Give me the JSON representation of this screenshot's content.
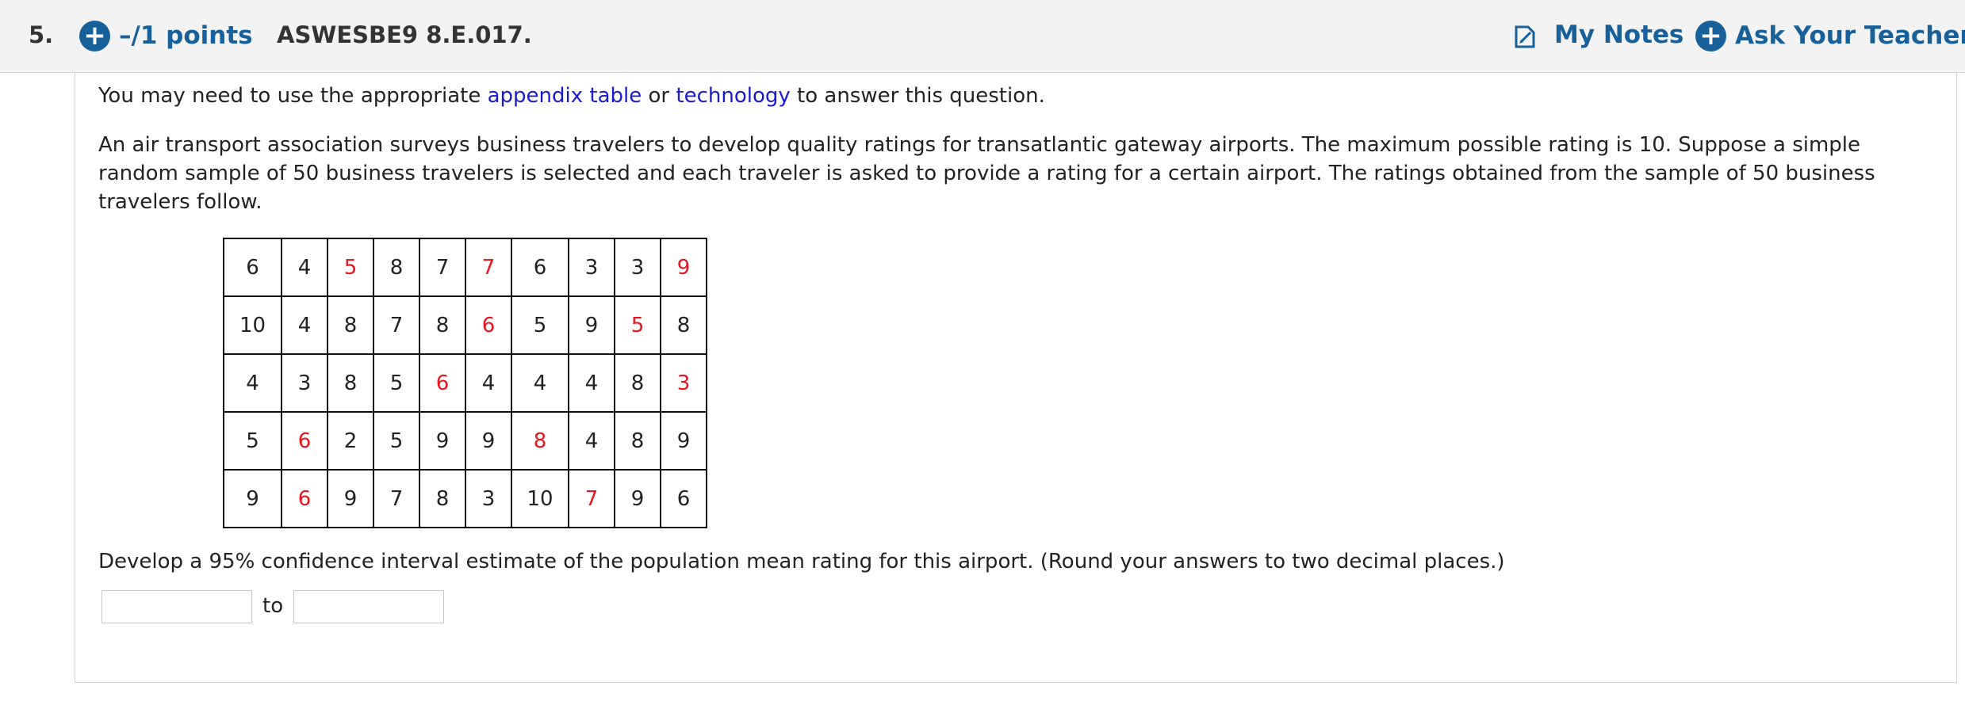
{
  "header": {
    "question_number": "5.",
    "points_label": "–/1 points",
    "question_id": "ASWESBE9 8.E.017.",
    "my_notes_label": "My Notes",
    "ask_teacher_label": "Ask Your Teacher"
  },
  "intro": {
    "prefix": "You may need to use the appropriate ",
    "link1": "appendix table",
    "middle": " or ",
    "link2": "technology",
    "suffix": " to answer this question."
  },
  "paragraph": "An air transport association surveys business travelers to develop quality ratings for transatlantic gateway airports. The maximum possible rating is 10. Suppose a simple random sample of 50 business travelers is selected and each traveler is asked to provide a rating for a certain airport. The ratings obtained from the sample of 50 business travelers follow.",
  "ratings_table": {
    "rows": [
      [
        {
          "v": "6"
        },
        {
          "v": "4"
        },
        {
          "v": "5",
          "red": true
        },
        {
          "v": "8"
        },
        {
          "v": "7"
        },
        {
          "v": "7",
          "red": true
        },
        {
          "v": "6"
        },
        {
          "v": "3"
        },
        {
          "v": "3"
        },
        {
          "v": "9",
          "red": true
        }
      ],
      [
        {
          "v": "10"
        },
        {
          "v": "4"
        },
        {
          "v": "8"
        },
        {
          "v": "7"
        },
        {
          "v": "8"
        },
        {
          "v": "6",
          "red": true
        },
        {
          "v": "5"
        },
        {
          "v": "9"
        },
        {
          "v": "5",
          "red": true
        },
        {
          "v": "8"
        }
      ],
      [
        {
          "v": "4"
        },
        {
          "v": "3"
        },
        {
          "v": "8"
        },
        {
          "v": "5"
        },
        {
          "v": "6",
          "red": true
        },
        {
          "v": "4"
        },
        {
          "v": "4"
        },
        {
          "v": "4"
        },
        {
          "v": "8"
        },
        {
          "v": "3",
          "red": true
        }
      ],
      [
        {
          "v": "5"
        },
        {
          "v": "6",
          "red": true
        },
        {
          "v": "2"
        },
        {
          "v": "5"
        },
        {
          "v": "9"
        },
        {
          "v": "9"
        },
        {
          "v": "8",
          "red": true
        },
        {
          "v": "4"
        },
        {
          "v": "8"
        },
        {
          "v": "9"
        }
      ],
      [
        {
          "v": "9"
        },
        {
          "v": "6",
          "red": true
        },
        {
          "v": "9"
        },
        {
          "v": "7"
        },
        {
          "v": "8"
        },
        {
          "v": "3"
        },
        {
          "v": "10"
        },
        {
          "v": "7",
          "red": true
        },
        {
          "v": "9"
        },
        {
          "v": "6"
        }
      ]
    ]
  },
  "question": "Develop a 95% confidence interval estimate of the population mean rating for this airport. (Round your answers to two decimal places.)",
  "answer": {
    "lower_value": "",
    "to_label": "to",
    "upper_value": ""
  },
  "colors": {
    "accent": "#17609a",
    "link": "#1a1ad0",
    "highlight": "#e8141e",
    "header_bg": "#f3f3f3"
  }
}
